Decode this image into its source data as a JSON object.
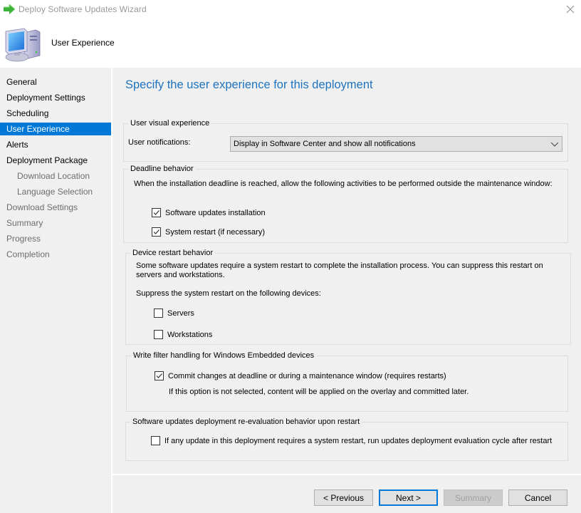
{
  "window": {
    "title": "Deploy Software Updates Wizard",
    "app_icon": "green-arrow-icon",
    "close_icon": "close-icon"
  },
  "header": {
    "icon": "computer-icon",
    "page_label": "User Experience"
  },
  "sidebar": {
    "items": [
      {
        "label": "General",
        "state": "normal",
        "level": 0
      },
      {
        "label": "Deployment Settings",
        "state": "normal",
        "level": 0
      },
      {
        "label": "Scheduling",
        "state": "normal",
        "level": 0
      },
      {
        "label": "User Experience",
        "state": "active",
        "level": 0
      },
      {
        "label": "Alerts",
        "state": "normal",
        "level": 0
      },
      {
        "label": "Deployment Package",
        "state": "normal",
        "level": 0
      },
      {
        "label": "Download Location",
        "state": "disabled",
        "level": 1
      },
      {
        "label": "Language Selection",
        "state": "disabled",
        "level": 1
      },
      {
        "label": "Download Settings",
        "state": "disabled",
        "level": 0
      },
      {
        "label": "Summary",
        "state": "disabled",
        "level": 0
      },
      {
        "label": "Progress",
        "state": "disabled",
        "level": 0
      },
      {
        "label": "Completion",
        "state": "disabled",
        "level": 0
      }
    ]
  },
  "main": {
    "heading": "Specify the user experience for this deployment",
    "user_visual": {
      "legend": "User visual experience",
      "notifications_label": "User notifications:",
      "notifications_value": "Display in Software Center and show all notifications"
    },
    "deadline": {
      "legend": "Deadline behavior",
      "description": "When the installation deadline is reached, allow the following activities to be performed outside the maintenance window:",
      "options": [
        {
          "label": "Software updates installation",
          "checked": true
        },
        {
          "label": "System restart (if necessary)",
          "checked": true
        }
      ]
    },
    "device_restart": {
      "legend": "Device restart behavior",
      "description": "Some software updates require a system restart to complete the installation process. You can suppress this restart on servers and workstations.",
      "suppress_label": "Suppress the system restart on the following devices:",
      "options": [
        {
          "label": "Servers",
          "checked": false
        },
        {
          "label": "Workstations",
          "checked": false
        }
      ]
    },
    "write_filter": {
      "legend": "Write filter handling for Windows Embedded devices",
      "option": {
        "label": "Commit changes at deadline or during a maintenance window (requires restarts)",
        "checked": true
      },
      "note": "If this option is not selected, content will be applied on the overlay and committed later."
    },
    "reevaluation": {
      "legend": "Software updates deployment re-evaluation behavior upon restart",
      "option": {
        "label": "If any update in this deployment requires a system restart, run updates deployment evaluation cycle after restart",
        "checked": false
      }
    }
  },
  "footer": {
    "previous": "< Previous",
    "next": "Next >",
    "summary": "Summary",
    "cancel": "Cancel"
  },
  "colors": {
    "accent": "#0078d7",
    "heading": "#1e73be",
    "panel_bg": "#f0f0f0"
  }
}
